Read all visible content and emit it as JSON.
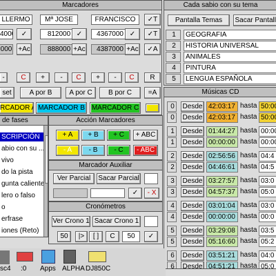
{
  "marcadores": {
    "title": "Marcadores",
    "names": [
      "LLERMO",
      "Mª JOSE",
      "FRANCISCO"
    ],
    "checks": [
      "✓",
      "✓",
      "✓"
    ],
    "title_btn": "✓T",
    "score_row1": [
      "4000",
      "812000",
      "4367000"
    ],
    "score_row1_btn": "✓T",
    "row2_values": [
      "000",
      "888000",
      "4387000"
    ],
    "ac_labels": [
      "+Ac",
      "+Ac",
      "+Ac"
    ],
    "row2_btn": "✓A",
    "pm_left": [
      "-",
      "C"
    ],
    "pm_mid": [
      "+",
      "-",
      "C"
    ],
    "pm_right": [
      "+",
      "-",
      "C"
    ],
    "r_btn": "R",
    "reset": "set",
    "a_por_b": "A por B",
    "a_por_c": "A por C",
    "b_por_c": "B por C",
    "eq_a": "=A",
    "marcador_a": "RCADOR A",
    "marcador_b": "MARCADOR B",
    "marcador_c": "MARCADOR C"
  },
  "fases": {
    "title": "de fases",
    "items": [
      "SCRIPCIÓN",
      "abio con su ...",
      "vivo",
      "do la pista",
      "gunta caliente",
      "lero o falso",
      "o",
      "erfrase",
      "iones (Reto)",
      "ntraciones"
    ],
    "colors": {
      "selected_bg": "#0000c0",
      "selected_fg": "#ffffff"
    }
  },
  "accion": {
    "title": "Acción Marcadores",
    "row1": [
      "+ A",
      "+ B",
      "+ C",
      "+ ABC"
    ],
    "row2": [
      "- A",
      "- B",
      "- C",
      "- ABC"
    ]
  },
  "auxiliar": {
    "title": "Marcador Auxiliar",
    "ver_parcial": "Ver Parcial",
    "sacar_parcial": "Sacar Parcial",
    "check": "✓",
    "minus_x": "- X"
  },
  "cronometros": {
    "title": "Cronómetros",
    "ver_crono": "Ver Crono 1",
    "sacar_crono": "Sacar Crono 1",
    "left_value": "50",
    "play": "|>",
    "stop": "[ ]",
    "reset_c": "C",
    "right_value": "50",
    "check": "✓"
  },
  "sabio": {
    "title": "Cada sabio con su tema",
    "pantalla": "Pantalla Temas",
    "sacar": "Sacar Pantalla",
    "numbers": [
      "1",
      "2",
      "3",
      "4",
      "5"
    ],
    "temas": [
      "GEOGRAFIA",
      "HISTORIA UNIVERSAL",
      "ANIMALES",
      "PINTURA",
      "LENGUA ESPAÑOLA"
    ],
    "checks": [
      "✓",
      "✓",
      "✓",
      "✓",
      "✓"
    ]
  },
  "musicas": {
    "title": "Músicas CD",
    "desde": "Desde",
    "hasta": "hasta",
    "rows": [
      {
        "n": "0",
        "time": "42:03:17",
        "hasta_time": "50:00",
        "highlight": true
      },
      {
        "n": "0",
        "time": "42:03:17",
        "hasta_time": "50:00",
        "highlight": true
      },
      {
        "n": "1",
        "time": "01:44:27",
        "hasta_time": "00:00",
        "highlight": false
      },
      {
        "n": "1",
        "time": "00:00:00",
        "hasta_time": "00:00",
        "highlight": false
      },
      {
        "n": "2",
        "time": "02:56:56",
        "hasta_time": "04:4",
        "highlight": false
      },
      {
        "n": "2",
        "time": "04:46:61",
        "hasta_time": "04:5",
        "highlight": false
      },
      {
        "n": "3",
        "time": "03:27:57",
        "hasta_time": "03:0",
        "highlight": false
      },
      {
        "n": "3",
        "time": "04:57:37",
        "hasta_time": "05:0",
        "highlight": false
      },
      {
        "n": "4",
        "time": "03:01:04",
        "hasta_time": "03:0",
        "highlight": false
      },
      {
        "n": "4",
        "time": "00:00:00",
        "hasta_time": "00:0",
        "highlight": false
      },
      {
        "n": "5",
        "time": "03:29:08",
        "hasta_time": "03:5",
        "highlight": false
      },
      {
        "n": "5",
        "time": "05:16:60",
        "hasta_time": "05:2",
        "highlight": false
      },
      {
        "n": "6",
        "time": "03:51:21",
        "hasta_time": "04:0",
        "highlight": false
      },
      {
        "n": "6",
        "time": "04:51:21",
        "hasta_time": "05:0",
        "highlight": false
      }
    ],
    "colors": {
      "time_bg_a": "#a9dcdc",
      "time_bg_b": "#c8e8a8",
      "highlight": "#f2b233",
      "hasta_bg": "#f2d233"
    }
  },
  "iconbar": {
    "items": [
      "sc4",
      ":0",
      "Apps",
      "ALPHA",
      "DJ850C"
    ]
  },
  "accent_colors": {
    "marcador_a": "#f2e600",
    "marcador_b": "#00c8f0",
    "marcador_c": "#22c422",
    "plus_a": "#f2e600",
    "plus_b": "#7cd8ee",
    "plus_c": "#22c422",
    "minus_abc": "#e02020",
    "list_bg": "#ffffff"
  }
}
